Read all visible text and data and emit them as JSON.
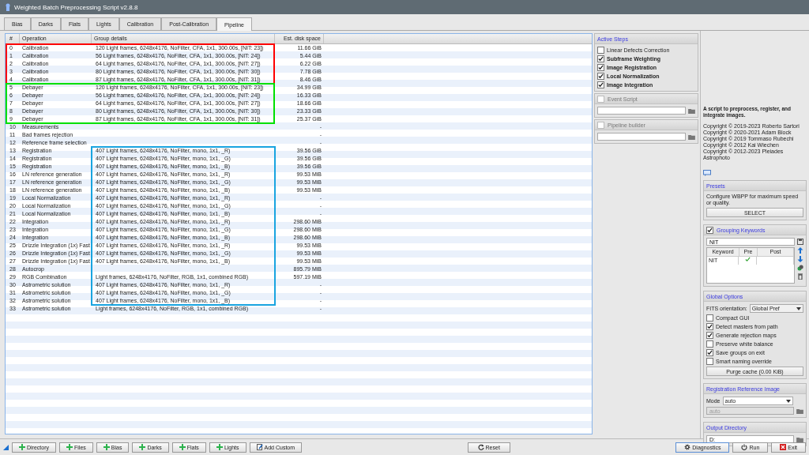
{
  "window": {
    "title": "Weighted Batch Preprocessing Script v2.8.8"
  },
  "tabs": [
    {
      "label": "Bias",
      "selected": false
    },
    {
      "label": "Darks",
      "selected": false
    },
    {
      "label": "Flats",
      "selected": false
    },
    {
      "label": "Lights",
      "selected": false
    },
    {
      "label": "Calibration",
      "selected": false
    },
    {
      "label": "Post-Calibration",
      "selected": false
    },
    {
      "label": "Pipeline",
      "selected": true
    }
  ],
  "table": {
    "columns": [
      "#",
      "Operation",
      "Group details",
      "Est. disk space"
    ],
    "row_groups": [
      {
        "color": "#ff0000",
        "kind": "rows",
        "rows": [
          {
            "num": "0",
            "operation": "Calibration",
            "details": "120 Light frames, 6248x4176, NoFilter, CFA, 1x1, 300.00s, [NIT: 23])",
            "size": "11.66 GiB"
          },
          {
            "num": "1",
            "operation": "Calibration",
            "details": "56 Light frames, 6248x4176, NoFilter, CFA, 1x1, 300.00s, [NIT: 24])",
            "size": "5.44 GiB"
          },
          {
            "num": "2",
            "operation": "Calibration",
            "details": "64 Light frames, 6248x4176, NoFilter, CFA, 1x1, 300.00s, [NIT: 27])",
            "size": "6.22 GiB"
          },
          {
            "num": "3",
            "operation": "Calibration",
            "details": "80 Light frames, 6248x4176, NoFilter, CFA, 1x1, 300.00s, [NIT: 30])",
            "size": "7.78 GiB"
          },
          {
            "num": "4",
            "operation": "Calibration",
            "details": "87 Light frames, 6248x4176, NoFilter, CFA, 1x1, 300.00s, [NIT: 31])",
            "size": "8.46 GiB"
          }
        ]
      },
      {
        "color": "#00e000",
        "kind": "rows",
        "rows": [
          {
            "num": "5",
            "operation": "Debayer",
            "details": "120 Light frames, 6248x4176, NoFilter, CFA, 1x1, 300.00s, [NIT: 23])",
            "size": "34.99 GiB"
          },
          {
            "num": "6",
            "operation": "Debayer",
            "details": "56 Light frames, 6248x4176, NoFilter, CFA, 1x1, 300.00s, [NIT: 24])",
            "size": "16.33 GiB"
          },
          {
            "num": "7",
            "operation": "Debayer",
            "details": "64 Light frames, 6248x4176, NoFilter, CFA, 1x1, 300.00s, [NIT: 27])",
            "size": "18.66 GiB"
          },
          {
            "num": "8",
            "operation": "Debayer",
            "details": "80 Light frames, 6248x4176, NoFilter, CFA, 1x1, 300.00s, [NIT: 30])",
            "size": "23.33 GiB"
          },
          {
            "num": "9",
            "operation": "Debayer",
            "details": "87 Light frames, 6248x4176, NoFilter, CFA, 1x1, 300.00s, [NIT: 31])",
            "size": "25.37 GiB"
          }
        ]
      },
      {
        "rows": [
          {
            "num": "10",
            "operation": "Measurements",
            "size": "-"
          },
          {
            "num": "11",
            "operation": "Bad frames rejection",
            "size": "-"
          },
          {
            "num": "12",
            "operation": "Reference frame selection",
            "size": "-"
          }
        ]
      },
      {
        "color": "#19a4e0",
        "kind": "details",
        "rows": [
          {
            "num": "13",
            "operation": "Registration",
            "details": "407 Light frames, 6248x4176, NoFilter, mono, 1x1, _R)",
            "size": "39.56 GiB"
          },
          {
            "num": "14",
            "operation": "Registration",
            "details": "407 Light frames, 6248x4176, NoFilter, mono, 1x1, _G)",
            "size": "39.56 GiB"
          },
          {
            "num": "15",
            "operation": "Registration",
            "details": "407 Light frames, 6248x4176, NoFilter, mono, 1x1, _B)",
            "size": "39.56 GiB"
          },
          {
            "num": "16",
            "operation": "LN reference generation",
            "details": "407 Light frames, 6248x4176, NoFilter, mono, 1x1, _R)",
            "size": "99.53 MiB"
          },
          {
            "num": "17",
            "operation": "LN reference generation",
            "details": "407 Light frames, 6248x4176, NoFilter, mono, 1x1, _G)",
            "size": "99.53 MiB"
          },
          {
            "num": "18",
            "operation": "LN reference generation",
            "details": "407 Light frames, 6248x4176, NoFilter, mono, 1x1, _B)",
            "size": "99.53 MiB"
          },
          {
            "num": "19",
            "operation": "Local Normalization",
            "details": "407 Light frames, 6248x4176, NoFilter, mono, 1x1, _R)",
            "size": "-"
          },
          {
            "num": "20",
            "operation": "Local Normalization",
            "details": "407 Light frames, 6248x4176, NoFilter, mono, 1x1, _G)",
            "size": "-"
          },
          {
            "num": "21",
            "operation": "Local Normalization",
            "details": "407 Light frames, 6248x4176, NoFilter, mono, 1x1, _B)",
            "size": "-"
          },
          {
            "num": "22",
            "operation": "Integration",
            "details": "407 Light frames, 6248x4176, NoFilter, mono, 1x1, _R)",
            "size": "298.60 MiB"
          },
          {
            "num": "23",
            "operation": "Integration",
            "details": "407 Light frames, 6248x4176, NoFilter, mono, 1x1, _G)",
            "size": "298.60 MiB"
          },
          {
            "num": "24",
            "operation": "Integration",
            "details": "407 Light frames, 6248x4176, NoFilter, mono, 1x1, _B)",
            "size": "298.60 MiB"
          },
          {
            "num": "25",
            "operation": "Drizzle Integration (1x) Fast",
            "details": "407 Light frames, 6248x4176, NoFilter, mono, 1x1, _R)",
            "size": "99.53 MiB"
          },
          {
            "num": "26",
            "operation": "Drizzle Integration (1x) Fast",
            "details": "407 Light frames, 6248x4176, NoFilter, mono, 1x1, _G)",
            "size": "99.53 MiB"
          },
          {
            "num": "27",
            "operation": "Drizzle Integration (1x) Fast",
            "details": "407 Light frames, 6248x4176, NoFilter, mono, 1x1, _B)",
            "size": "99.53 MiB"
          },
          {
            "num": "28",
            "operation": "Autocrop",
            "size": "895.79 MiB"
          },
          {
            "num": "29",
            "operation": "RGB Combination",
            "details": "Light frames, 6248x4176, NoFilter, RGB, 1x1, combined RGB)",
            "size": "597.19 MiB"
          },
          {
            "num": "30",
            "operation": "Astrometric solution",
            "details": "407 Light frames, 6248x4176, NoFilter, mono, 1x1, _R)",
            "size": "-"
          },
          {
            "num": "31",
            "operation": "Astrometric solution",
            "details": "407 Light frames, 6248x4176, NoFilter, mono, 1x1, _G)",
            "size": "-"
          },
          {
            "num": "32",
            "operation": "Astrometric solution",
            "details": "407 Light frames, 6248x4176, NoFilter, mono, 1x1, _B)",
            "size": "-"
          }
        ]
      },
      {
        "rows": [
          {
            "num": "33",
            "operation": "Astrometric solution",
            "details": "Light frames, 6248x4176, NoFilter, RGB, 1x1, combined RGB)",
            "size": "-"
          }
        ]
      }
    ]
  },
  "active_steps": {
    "title": "Active Steps",
    "items": [
      {
        "label": "Linear Defects Correction",
        "checked": false
      },
      {
        "label": "Subframe Weighting",
        "checked": true
      },
      {
        "label": "Image Registration",
        "checked": true
      },
      {
        "label": "Local Normalization",
        "checked": true
      },
      {
        "label": "Image Integration",
        "checked": true
      }
    ]
  },
  "event_script": {
    "label": "Event Script",
    "checked": false
  },
  "pipeline_builder": {
    "label": "Pipeline builder",
    "checked": false
  },
  "about": {
    "description": "A script to preprocess, register, and integrate images.",
    "copyright": [
      "Copyright © 2019-2023 Roberto Sartori",
      "Copyright © 2020-2021 Adam Block",
      "Copyright © 2019 Tommaso Rubechi",
      "Copyright © 2012 Kai Wiechen",
      "Copyright © 2012-2023 Pleiades Astrophoto"
    ]
  },
  "presets": {
    "title": "Presets",
    "description": "Configure WBPP for maximum speed or quality.",
    "button": "SELECT"
  },
  "grouping": {
    "title": "Grouping Keywords",
    "checked": true,
    "value": "NIT",
    "columns": [
      "Keyword",
      "Pre",
      "Post"
    ],
    "rows": [
      {
        "keyword": "NIT",
        "pre": true,
        "post": false
      }
    ]
  },
  "global_options": {
    "title": "Global Options",
    "fits_label": "FITS orientation:",
    "fits_value": "Global Pref",
    "options": [
      {
        "label": "Compact GUI",
        "checked": false
      },
      {
        "label": "Detect masters from path",
        "checked": true
      },
      {
        "label": "Generate rejection maps",
        "checked": true
      },
      {
        "label": "Preserve white balance",
        "checked": false
      },
      {
        "label": "Save groups on exit",
        "checked": true
      },
      {
        "label": "Smart naming override",
        "checked": false
      }
    ],
    "purge_button": "Purge cache (0.00 KiB)"
  },
  "registration": {
    "title": "Registration Reference Image",
    "mode_label": "Mode",
    "mode_value": "auto",
    "path_value": "auto"
  },
  "output": {
    "title": "Output Directory",
    "value": "D:"
  },
  "bottom_left": [
    {
      "label": "Directory",
      "kind": "add"
    },
    {
      "label": "Files",
      "kind": "add"
    },
    {
      "label": "Bias",
      "kind": "add"
    },
    {
      "label": "Darks",
      "kind": "add"
    },
    {
      "label": "Flats",
      "kind": "add"
    },
    {
      "label": "Lights",
      "kind": "add"
    },
    {
      "label": "Add Custom",
      "kind": "custom"
    }
  ],
  "reset": {
    "label": "Reset"
  },
  "bottom_right": [
    {
      "label": "Diagnostics",
      "kind": "gear"
    },
    {
      "label": "Run",
      "kind": "power"
    },
    {
      "label": "Exit",
      "kind": "exit"
    }
  ]
}
